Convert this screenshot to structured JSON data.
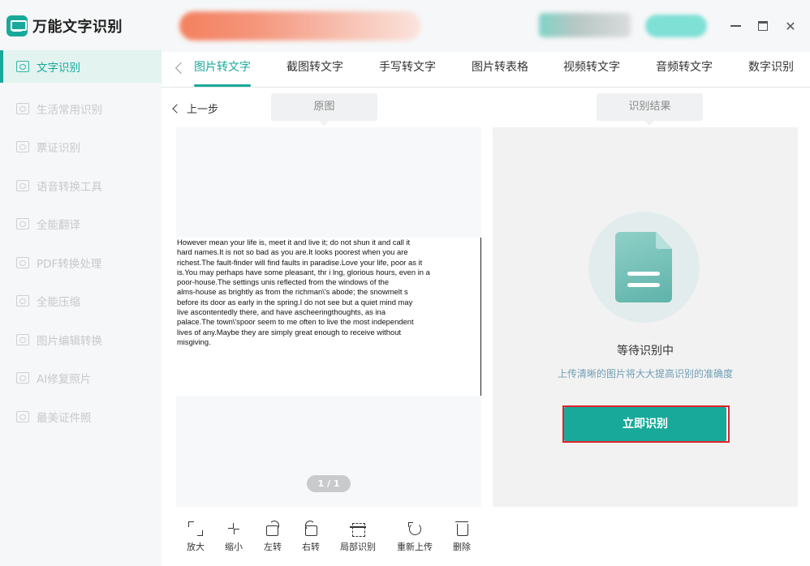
{
  "app": {
    "name": "万能文字识别"
  },
  "sidebar": {
    "items": [
      {
        "label": "文字识别",
        "active": true
      },
      {
        "label": "生活常用识别"
      },
      {
        "label": "票证识别"
      },
      {
        "label": "语音转换工具"
      },
      {
        "label": "全能翻译"
      },
      {
        "label": "PDF转换处理"
      },
      {
        "label": "全能压缩"
      },
      {
        "label": "图片编辑转换"
      },
      {
        "label": "AI修复照片"
      },
      {
        "label": "最美证件照"
      }
    ]
  },
  "window": {
    "close_glyph": "✕"
  },
  "tabs": [
    {
      "label": "图片转文字",
      "active": true
    },
    {
      "label": "截图转文字"
    },
    {
      "label": "手写转文字"
    },
    {
      "label": "图片转表格"
    },
    {
      "label": "视频转文字"
    },
    {
      "label": "音频转文字"
    },
    {
      "label": "数字识别"
    }
  ],
  "workspace": {
    "prev_step": "上一步",
    "original_label": "原图",
    "result_label": "识别结果",
    "document_text": "However mean your life is,  meet it and live it;  do not shun it and call it\nhard names.It is not so bad as you are.It looks poorest when you are\nrichest.The fault-finder will find faults in paradise.Love your life,  poor as it\nis.You may perhaps have some pleasant,  thr i lng,  glorious hours,  even in a\npoor-house.The settings unis reflected from the windows of the\nalms-house as brightly as from the richman\\'s abode;  the snowmelt s\nbefore its door as early in the spring.I do not see but a quiet mind may\nlive ascontentedly there,  and have ascheeringthoughts,  as ina\npalace.The town\\'spoor seem to me often to live the most independent\nlives of any.Maybe they are simply great enough to receive without\nmisgiving.",
    "page_indicator": "1 / 1",
    "status_title": "等待识别中",
    "status_hint": "上传清晰的图片将大大提高识别的准确度",
    "recognize_button": "立即识别"
  },
  "toolbar": {
    "zoom_in": "放大",
    "zoom_out": "缩小",
    "rotate_left": "左转",
    "rotate_right": "右转",
    "partial_recognize": "局部识别",
    "reupload": "重新上传",
    "delete": "删除"
  },
  "colors": {
    "accent": "#19a99a",
    "highlight_outline": "#e0222a"
  }
}
